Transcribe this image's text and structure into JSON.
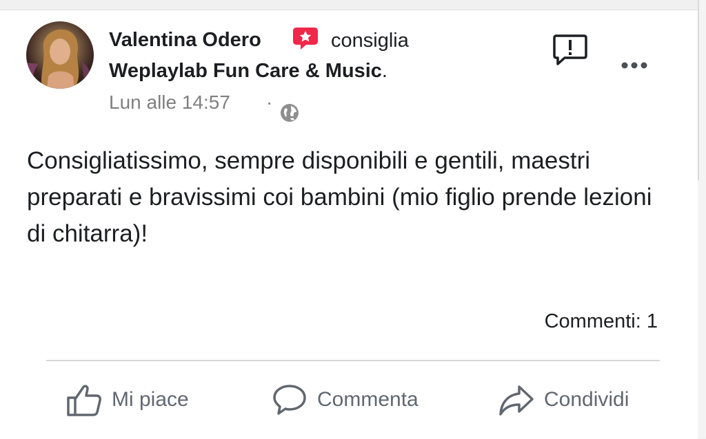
{
  "post": {
    "author": "Valentina Odero",
    "verb": "consiglia",
    "page_name": "Weplaylab Fun Care & Music",
    "page_suffix": ".",
    "time": "Lun alle 14:57",
    "separator": "·",
    "privacy_icon": "globe-icon",
    "badge_icon": "recommendation-star-icon",
    "report_icon": "report-flag-icon",
    "more_icon": "more-options-icon",
    "text": "Consigliatissimo, sempre disponibili e gentili, maestri preparati e bravissimi coi bambini (mio figlio prende lezioni di chitarra)!",
    "comments_count": "Commenti: 1"
  },
  "actions": {
    "like": "Mi piace",
    "comment": "Commenta",
    "share": "Condividi"
  },
  "colors": {
    "badge_red": "#f0284a",
    "text": "#1c1e21",
    "muted": "#7f7f7f",
    "action_gray": "#606770"
  }
}
